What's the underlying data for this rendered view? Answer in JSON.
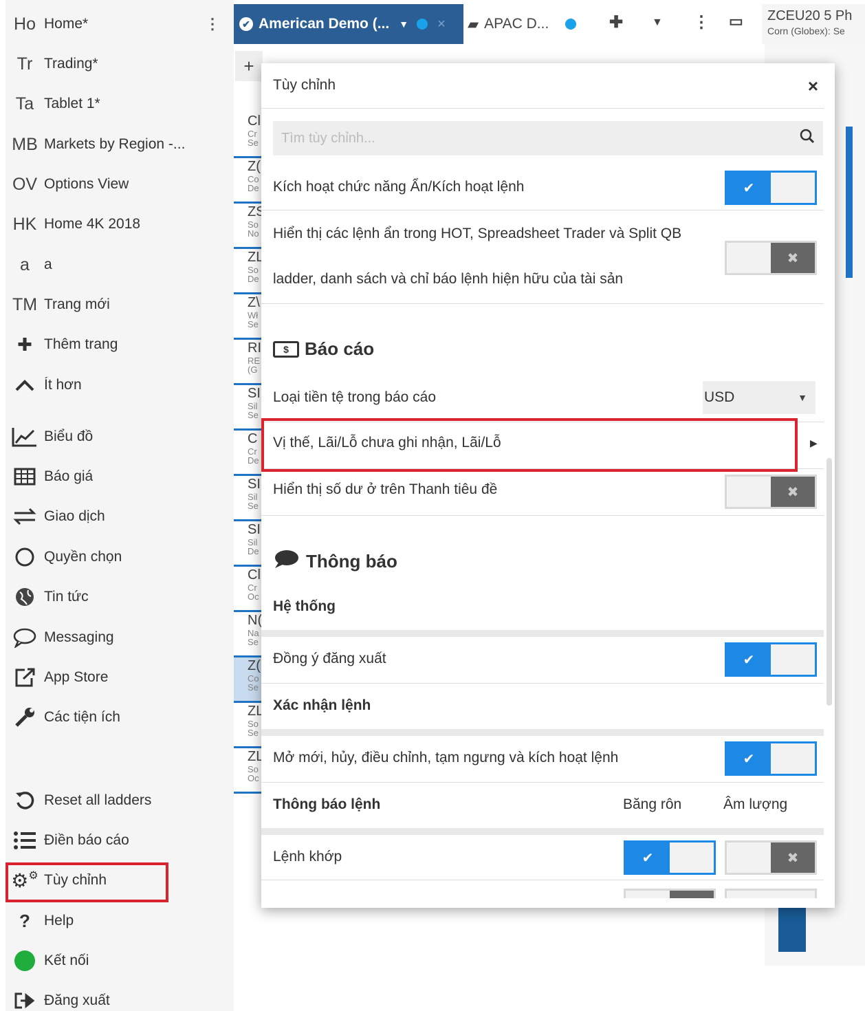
{
  "sidebar": {
    "items": [
      {
        "abbr": "Ho",
        "label": "Home*"
      },
      {
        "abbr": "Tr",
        "label": "Trading*"
      },
      {
        "abbr": "Ta",
        "label": "Tablet 1*"
      },
      {
        "abbr": "MB",
        "label": "Markets by Region -..."
      },
      {
        "abbr": "OV",
        "label": "Options View"
      },
      {
        "abbr": "HK",
        "label": "Home 4K 2018"
      },
      {
        "abbr": "a",
        "label": "a"
      },
      {
        "abbr": "TM",
        "label": "Trang mới"
      },
      {
        "icon": "plus-icon",
        "glyph": "✚",
        "label": "Thêm trang"
      },
      {
        "icon": "chevron-up-icon",
        "glyph": "︿",
        "label": "Ít hơn"
      },
      {
        "icon": "chart-icon",
        "glyph": "📈",
        "label": "Biểu đồ"
      },
      {
        "icon": "table-icon",
        "glyph": "▦",
        "label": "Báo giá"
      },
      {
        "icon": "swap-icon",
        "glyph": "⇄",
        "label": "Giao dịch"
      },
      {
        "icon": "circle-icon",
        "glyph": "◯",
        "label": "Quyền chọn"
      },
      {
        "icon": "globe-icon",
        "glyph": "◕",
        "label": "Tin tức"
      },
      {
        "icon": "chat-bubble-icon",
        "glyph": "💬",
        "label": "Messaging"
      },
      {
        "icon": "external-link-icon",
        "glyph": "⧉",
        "label": "App Store"
      },
      {
        "icon": "wrench-icon",
        "glyph": "🔧",
        "label": "Các tiện ích"
      },
      {
        "icon": "reset-icon",
        "glyph": "↺",
        "label": "Reset all ladders"
      },
      {
        "icon": "list-icon",
        "glyph": "☰",
        "label": "Điền báo cáo"
      },
      {
        "icon": "gears-icon",
        "glyph": "⚙",
        "label": "Tùy chỉnh"
      },
      {
        "icon": "help-icon",
        "glyph": "?",
        "label": "Help"
      },
      {
        "icon": "status-dot-icon",
        "glyph": "●",
        "label": "Kết nối"
      },
      {
        "icon": "logout-icon",
        "glyph": "⇥",
        "label": "Đăng xuất"
      }
    ]
  },
  "tabs": {
    "active": "American Demo (...",
    "second": "APAC D...",
    "zceu_title": "ZCEU20 5 Ph",
    "zceu_sub": "Corn (Globex): Se"
  },
  "bg_rows": [
    {
      "a": "Cl",
      "b": "Cr Se"
    },
    {
      "a": "Z(",
      "b": "Co De"
    },
    {
      "a": "ZS",
      "b": "So No"
    },
    {
      "a": "ZL",
      "b": "So De"
    },
    {
      "a": "Z\\",
      "b": "Wł Se"
    },
    {
      "a": "RI",
      "b": "RE (G"
    },
    {
      "a": "SI",
      "b": "Sil Se"
    },
    {
      "a": "C",
      "b": "Cr De"
    },
    {
      "a": "SI",
      "b": "Sil Se"
    },
    {
      "a": "SI",
      "b": "Sil De"
    },
    {
      "a": "Cl",
      "b": "Cr Oc"
    },
    {
      "a": "N(",
      "b": "Na Se"
    },
    {
      "a": "Z(",
      "b": "Co Se"
    },
    {
      "a": "ZL",
      "b": "So Se"
    },
    {
      "a": "ZL",
      "b": "So Oc"
    }
  ],
  "modal": {
    "title": "Tùy chỉnh",
    "search_placeholder": "Tìm tùy chỉnh...",
    "r1": "Kích hoạt chức năng Ẩn/Kích hoạt lệnh",
    "r2a": "Hiển thị các lệnh ẩn trong HOT, Spreadsheet Trader và Split QB",
    "r2b": "ladder, danh sách và chỉ báo lệnh hiện hữu của tài sản",
    "sec_report": "Báo cáo",
    "currency_label": "Loại tiền tệ trong báo cáo",
    "currency_value": "USD",
    "pnl": "Vị thế, Lãi/Lỗ chưa ghi nhận, Lãi/Lỗ",
    "balance": "Hiển thị số dư ở trên Thanh tiêu đề",
    "sec_notify": "Thông báo",
    "system": "Hệ thống",
    "logout_confirm": "Đồng ý đăng xuất",
    "order_confirm": "Xác nhận lệnh",
    "order_actions": "Mở mới, hủy, điều chỉnh, tạm ngưng và kích hoạt lệnh",
    "order_notify": "Thông báo lệnh",
    "col_banner": "Băng rôn",
    "col_sound": "Âm lượng",
    "fill": "Lệnh khớp"
  },
  "colors": {
    "accent": "#1e88e5",
    "highlight": "#d9232e",
    "tab": "#2a5e95"
  }
}
